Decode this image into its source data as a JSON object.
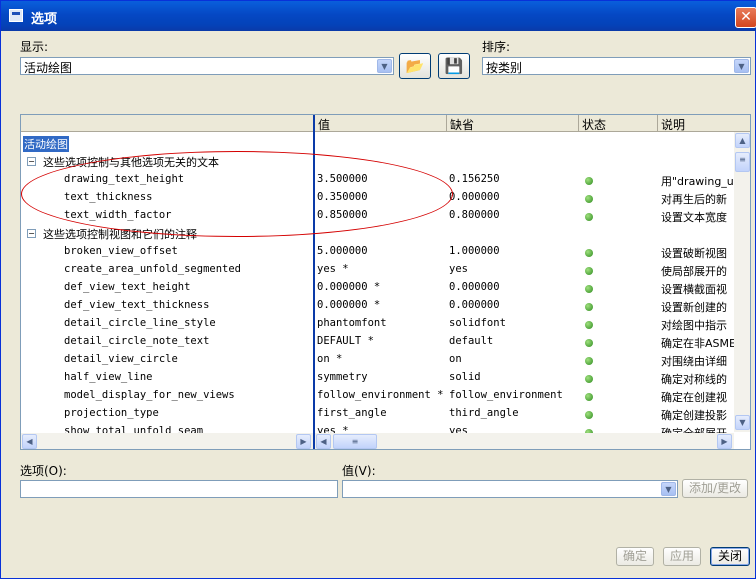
{
  "window": {
    "title": "选项",
    "close_glyph": "✕"
  },
  "display": {
    "label": "显示:",
    "value": "活动绘图"
  },
  "sort": {
    "label": "排序:",
    "value": "按类别"
  },
  "columns": {
    "value": "值",
    "default": "缺省",
    "status": "状态",
    "desc": "说明"
  },
  "tree": {
    "root": "活动绘图",
    "group1": "这些选项控制与其他选项无关的文本",
    "group2": "这些选项控制视图和它们的注释",
    "rows1": [
      {
        "name": "drawing_text_height",
        "value": "3.500000",
        "default": "0.156250",
        "desc": "用\"drawing_u"
      },
      {
        "name": "text_thickness",
        "value": "0.350000",
        "default": "0.000000",
        "desc": "对再生后的新"
      },
      {
        "name": "text_width_factor",
        "value": "0.850000",
        "default": "0.800000",
        "desc": "设置文本宽度"
      }
    ],
    "rows2": [
      {
        "name": "broken_view_offset",
        "value": "5.000000",
        "default": "1.000000",
        "desc": "设置破断视图"
      },
      {
        "name": "create_area_unfold_segmented",
        "value": "yes *",
        "default": "yes",
        "desc": "使局部展开的"
      },
      {
        "name": "def_view_text_height",
        "value": "0.000000 *",
        "default": "0.000000",
        "desc": "设置横截面视"
      },
      {
        "name": "def_view_text_thickness",
        "value": "0.000000 *",
        "default": "0.000000",
        "desc": "设置新创建的"
      },
      {
        "name": "detail_circle_line_style",
        "value": "phantomfont",
        "default": "solidfont",
        "desc": "对绘图中指示"
      },
      {
        "name": "detail_circle_note_text",
        "value": "DEFAULT *",
        "default": "default",
        "desc": "确定在非ASME"
      },
      {
        "name": "detail_view_circle",
        "value": "on *",
        "default": "on",
        "desc": "对围绕由详细"
      },
      {
        "name": "half_view_line",
        "value": "symmetry",
        "default": "solid",
        "desc": "确定对称线的"
      },
      {
        "name": "model_display_for_new_views",
        "value": "follow_environment *",
        "default": "follow_environment",
        "desc": "确定在创建视"
      },
      {
        "name": "projection_type",
        "value": "first_angle",
        "default": "third_angle",
        "desc": "确定创建投影"
      },
      {
        "name": "show_total_unfold_seam",
        "value": "yes *",
        "default": "yes",
        "desc": "确定全部展开"
      }
    ]
  },
  "option": {
    "label": "选项(O):",
    "value": ""
  },
  "value_field": {
    "label": "值(V):",
    "value": ""
  },
  "buttons": {
    "add": "添加/更改",
    "ok": "确定",
    "apply": "应用",
    "close": "关闭"
  },
  "icons": {
    "open": "open-folder-icon",
    "save": "save-config-icon"
  }
}
